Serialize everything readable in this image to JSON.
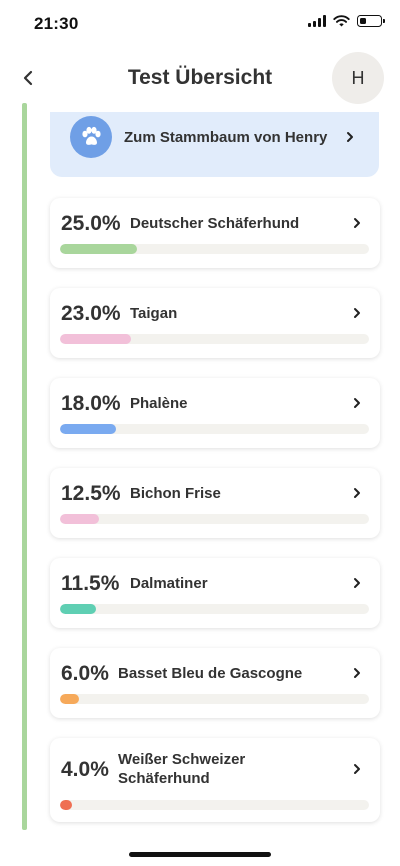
{
  "status_bar": {
    "time": "21:30"
  },
  "header": {
    "title": "Test Übersicht",
    "avatar_initial": "H"
  },
  "family_tree": {
    "label": "Zum Stammbaum von Henry",
    "icon": "paw-icon",
    "color": "#6f9fe6"
  },
  "colors": {
    "side_line": "#a9d69c",
    "family_bg": "#e1ecfb",
    "track": "#f3f2ee"
  },
  "breeds": [
    {
      "percent_label": "25.0%",
      "name": "Deutscher Schäferhund",
      "value": 25.0,
      "color": "#a9d69c"
    },
    {
      "percent_label": "23.0%",
      "name": "Taigan",
      "value": 23.0,
      "color": "#f2c0d9"
    },
    {
      "percent_label": "18.0%",
      "name": "Phalène",
      "value": 18.0,
      "color": "#7aaaf0"
    },
    {
      "percent_label": "12.5%",
      "name": "Bichon Frise",
      "value": 12.5,
      "color": "#f2c0d9"
    },
    {
      "percent_label": "11.5%",
      "name": "Dalmatiner",
      "value": 11.5,
      "color": "#5fcfb3"
    },
    {
      "percent_label": "6.0%",
      "name": "Basset Bleu de Gascogne",
      "value": 6.0,
      "color": "#f6a95a"
    },
    {
      "percent_label": "4.0%",
      "name": "Weißer Schweizer Schäferhund",
      "value": 4.0,
      "color": "#ef6f52"
    }
  ]
}
